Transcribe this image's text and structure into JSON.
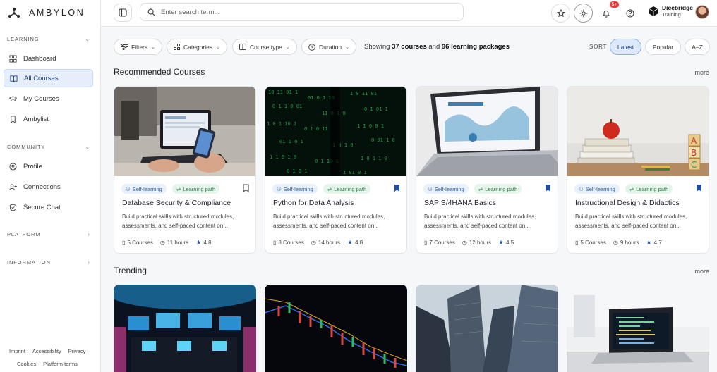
{
  "app": {
    "logo_text": "AMBYLON"
  },
  "sidebar": {
    "sections": {
      "learning": "LEARNING",
      "community": "COMMUNITY",
      "platform": "PLATFORM",
      "information": "INFORMATION"
    },
    "items": [
      {
        "label": "Dashboard",
        "icon": "grid-icon"
      },
      {
        "label": "All Courses",
        "icon": "book-open-icon",
        "active": true
      },
      {
        "label": "My Courses",
        "icon": "graduation-cap-icon"
      },
      {
        "label": "Ambylist",
        "icon": "bookmark-icon"
      },
      {
        "label": "Profile",
        "icon": "user-circle-icon"
      },
      {
        "label": "Connections",
        "icon": "user-plus-icon"
      },
      {
        "label": "Secure Chat",
        "icon": "shield-icon"
      }
    ],
    "footer": [
      "Imprint",
      "Accessibility",
      "Privacy",
      "Cookies",
      "Platform terms"
    ]
  },
  "topbar": {
    "search_placeholder": "Enter search term...",
    "notification_badge": "5+",
    "brand_line1": "Dicebridge",
    "brand_line2": "Training"
  },
  "filters": {
    "chips": [
      "Filters",
      "Categories",
      "Course type",
      "Duration"
    ],
    "showing_prefix": "Showing",
    "course_count": "37 courses",
    "and": "and",
    "package_count": "96 learning packages",
    "sort_label": "SORT",
    "sort_options": [
      "Latest",
      "Popular",
      "A–Z"
    ],
    "sort_active": "Latest"
  },
  "recommended": {
    "title": "Recommended Courses",
    "more": "more",
    "tag_self": "Self-learning",
    "tag_path": "Learning path",
    "cards": [
      {
        "title": "Database Security & Compliance",
        "desc": "Build practical skills with structured modules, assessments, and self-paced content on...",
        "courses": "5 Courses",
        "hours": "11 hours",
        "rating": "4.8",
        "bookmarked": false
      },
      {
        "title": "Python for Data Analysis",
        "desc": "Build practical skills with structured modules, assessments, and self-paced content on...",
        "courses": "8 Courses",
        "hours": "14 hours",
        "rating": "4.8",
        "bookmarked": true
      },
      {
        "title": "SAP S/4HANA Basics",
        "desc": "Build practical skills with structured modules, assessments, and self-paced content on...",
        "courses": "7 Courses",
        "hours": "12 hours",
        "rating": "4.5",
        "bookmarked": true
      },
      {
        "title": "Instructional Design & Didactics",
        "desc": "Build practical skills with structured modules, assessments, and self-paced content on...",
        "courses": "5 Courses",
        "hours": "9 hours",
        "rating": "4.7",
        "bookmarked": true
      }
    ]
  },
  "trending": {
    "title": "Trending",
    "more": "more"
  }
}
